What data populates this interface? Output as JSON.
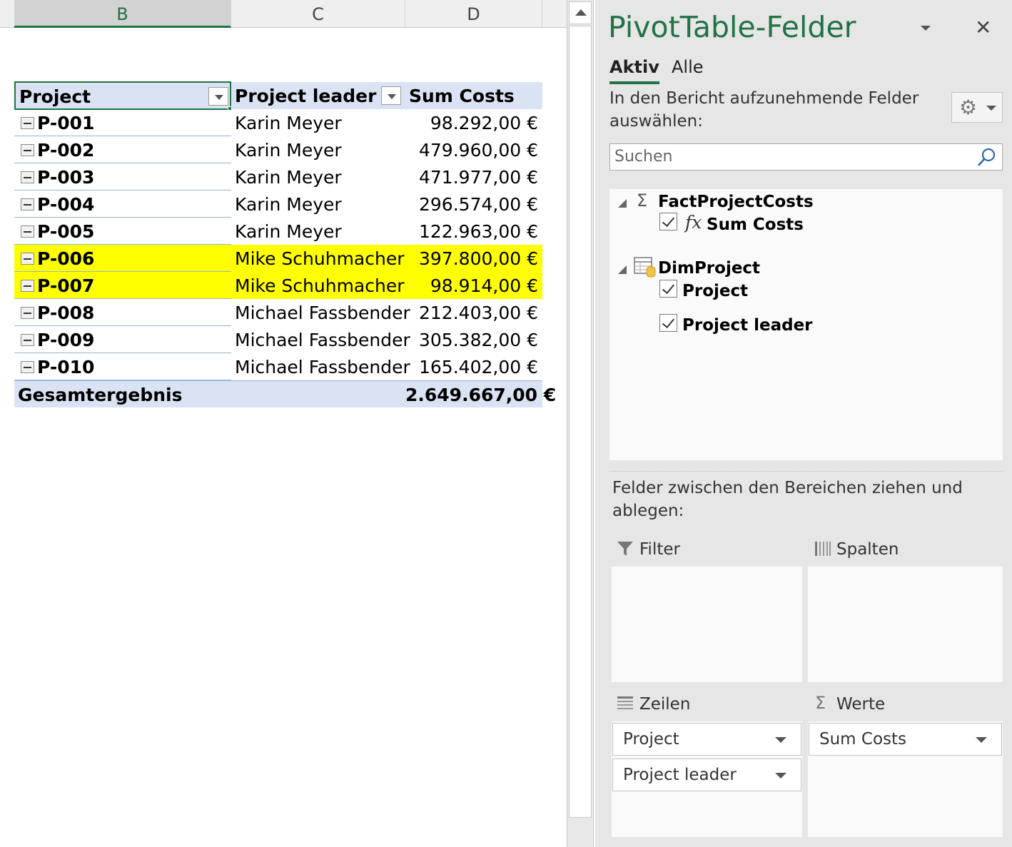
{
  "columns": [
    "B",
    "C",
    "D"
  ],
  "pivot": {
    "headers": {
      "project": "Project",
      "leader": "Project leader",
      "costs": "Sum Costs"
    },
    "rows": [
      {
        "project": "P-001",
        "leader": "Karin Meyer",
        "costs": "98.292,00 €",
        "highlight": false
      },
      {
        "project": "P-002",
        "leader": "Karin Meyer",
        "costs": "479.960,00 €",
        "highlight": false
      },
      {
        "project": "P-003",
        "leader": "Karin Meyer",
        "costs": "471.977,00 €",
        "highlight": false
      },
      {
        "project": "P-004",
        "leader": "Karin Meyer",
        "costs": "296.574,00 €",
        "highlight": false
      },
      {
        "project": "P-005",
        "leader": "Karin Meyer",
        "costs": "122.963,00 €",
        "highlight": false
      },
      {
        "project": "P-006",
        "leader": "Mike Schuhmacher",
        "costs": "397.800,00 €",
        "highlight": true
      },
      {
        "project": "P-007",
        "leader": "Mike Schuhmacher",
        "costs": "98.914,00 €",
        "highlight": true
      },
      {
        "project": "P-008",
        "leader": "Michael Fassbender",
        "costs": "212.403,00 €",
        "highlight": false
      },
      {
        "project": "P-009",
        "leader": "Michael Fassbender",
        "costs": "305.382,00 €",
        "highlight": false
      },
      {
        "project": "P-010",
        "leader": "Michael Fassbender",
        "costs": "165.402,00 €",
        "highlight": false
      }
    ],
    "total": {
      "label": "Gesamtergebnis",
      "costs": "2.649.667,00 €"
    }
  },
  "pane": {
    "title": "PivotTable-Felder",
    "tabs": {
      "active": "Aktiv",
      "all": "Alle"
    },
    "instruction": "In den Bericht aufzunehmende Felder auswählen:",
    "search_placeholder": "Suchen",
    "tables": [
      {
        "name": "FactProjectCosts",
        "icon": "sigma-icon",
        "fields": [
          {
            "prefix": "fx",
            "name": "Sum Costs",
            "checked": true
          }
        ]
      },
      {
        "name": "DimProject",
        "icon": "table-icon",
        "fields": [
          {
            "name": "Project",
            "checked": true
          },
          {
            "name": "Project leader",
            "checked": true
          }
        ]
      }
    ],
    "drag_instruction": "Felder zwischen den Bereichen ziehen und ablegen:",
    "areas": {
      "filter": {
        "label": "Filter",
        "items": []
      },
      "columns": {
        "label": "Spalten",
        "items": []
      },
      "rows": {
        "label": "Zeilen",
        "items": [
          "Project",
          "Project leader"
        ]
      },
      "values": {
        "label": "Werte",
        "items": [
          "Sum Costs"
        ]
      }
    }
  },
  "colors": {
    "accent": "#217346",
    "highlight": "#ffff00",
    "pivot_header": "#dae3f3"
  }
}
